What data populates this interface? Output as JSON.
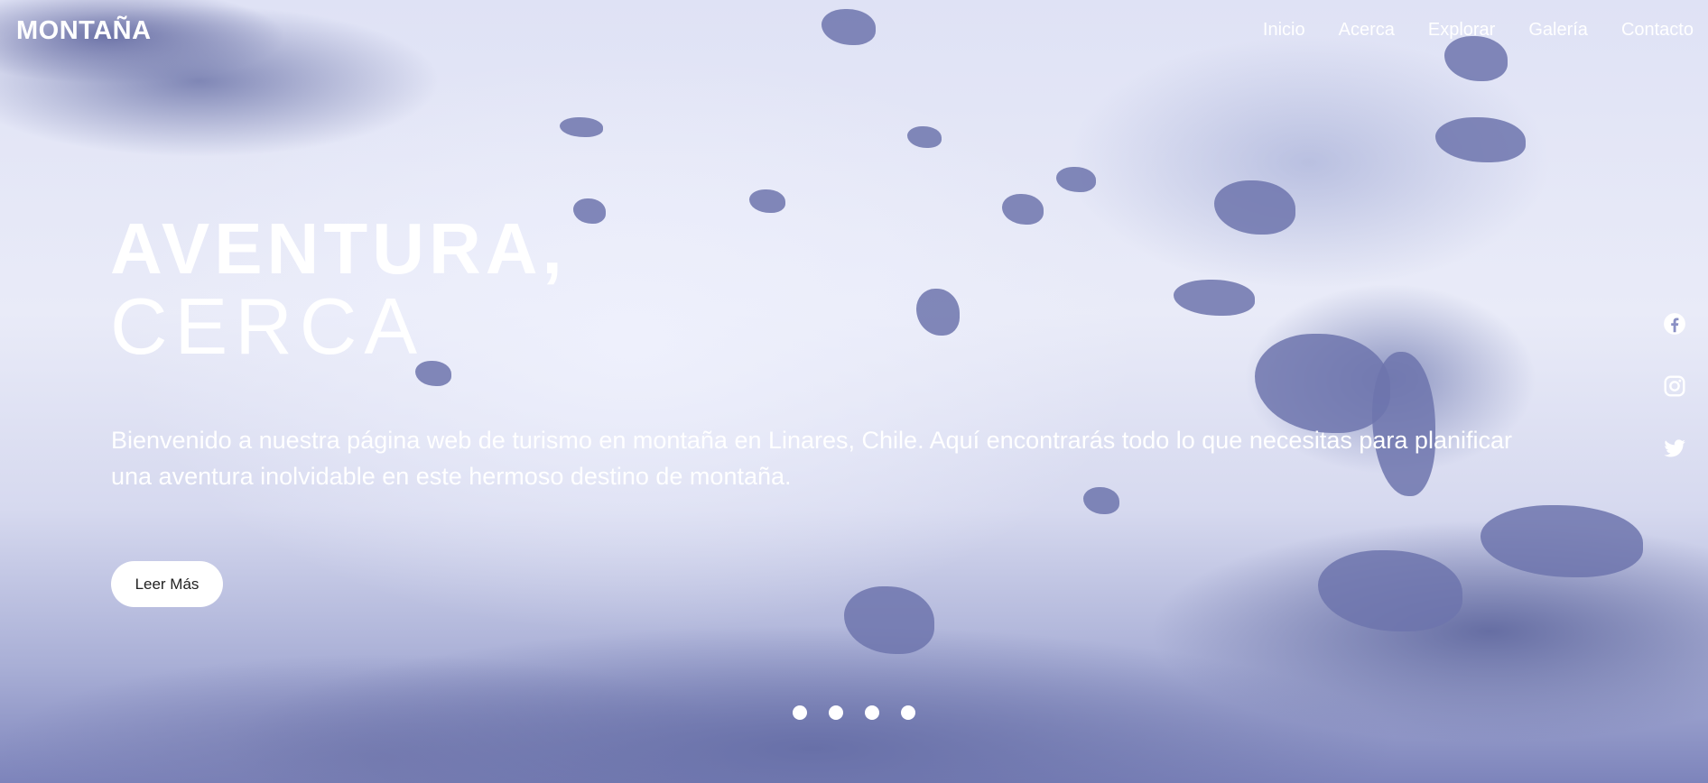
{
  "brand": {
    "logo_text": "MONTAÑA"
  },
  "nav": {
    "items": [
      {
        "label": "Inicio"
      },
      {
        "label": "Acerca"
      },
      {
        "label": "Explorar"
      },
      {
        "label": "Galería"
      },
      {
        "label": "Contacto"
      }
    ]
  },
  "hero": {
    "title_line1": "AVENTURA,",
    "title_line2": "CERCA",
    "intro": "Bienvenido a nuestra página web de turismo en montaña en Linares, Chile. Aquí encontrarás todo lo que necesitas para planificar una aventura inolvidable en este hermoso destino de montaña.",
    "cta_label": "Leer Más",
    "background": "snowy mountain slope with scattered rocks",
    "text_color": "#ffffff"
  },
  "social": {
    "icons": [
      "facebook-icon",
      "instagram-icon",
      "twitter-icon"
    ]
  },
  "slider": {
    "dot_count": 4
  }
}
